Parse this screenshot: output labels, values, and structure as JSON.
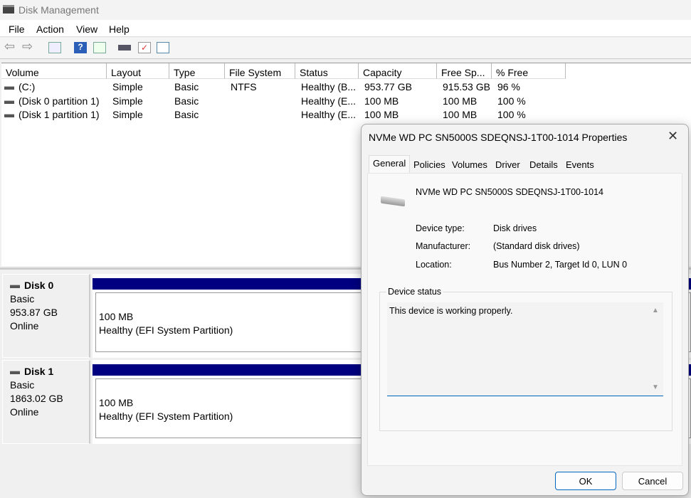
{
  "window": {
    "title": "Disk Management"
  },
  "menu": [
    "File",
    "Action",
    "View",
    "Help"
  ],
  "list": {
    "headers": [
      "Volume",
      "Layout",
      "Type",
      "File System",
      "Status",
      "Capacity",
      "Free Sp...",
      "% Free"
    ],
    "rows": [
      [
        "(C:)",
        "Simple",
        "Basic",
        "NTFS",
        "Healthy (B...",
        "953.77 GB",
        "915.53 GB",
        "96 %"
      ],
      [
        "(Disk 0 partition 1)",
        "Simple",
        "Basic",
        "",
        "Healthy (E...",
        "100 MB",
        "100 MB",
        "100 %"
      ],
      [
        "(Disk 1 partition 1)",
        "Simple",
        "Basic",
        "",
        "Healthy (E...",
        "100 MB",
        "100 MB",
        "100 %"
      ]
    ]
  },
  "disks": [
    {
      "name": "Disk 0",
      "type": "Basic",
      "size": "953.87 GB",
      "state": "Online",
      "part_size": "100 MB",
      "part_status": "Healthy (EFI System Partition)"
    },
    {
      "name": "Disk 1",
      "type": "Basic",
      "size": "1863.02 GB",
      "state": "Online",
      "part_size": "100 MB",
      "part_status": "Healthy (EFI System Partition)"
    }
  ],
  "dialog": {
    "title": "NVMe WD PC SN5000S SDEQNSJ-1T00-1014 Properties",
    "tabs": [
      "General",
      "Policies",
      "Volumes",
      "Driver",
      "Details",
      "Events"
    ],
    "device_name": "NVMe WD PC SN5000S SDEQNSJ-1T00-1014",
    "device_type_label": "Device type:",
    "device_type": "Disk drives",
    "manufacturer_label": "Manufacturer:",
    "manufacturer": "(Standard disk drives)",
    "location_label": "Location:",
    "location": "Bus Number 2, Target Id 0, LUN 0",
    "status_group": "Device status",
    "status_text": "This device is working properly.",
    "ok": "OK",
    "cancel": "Cancel"
  }
}
